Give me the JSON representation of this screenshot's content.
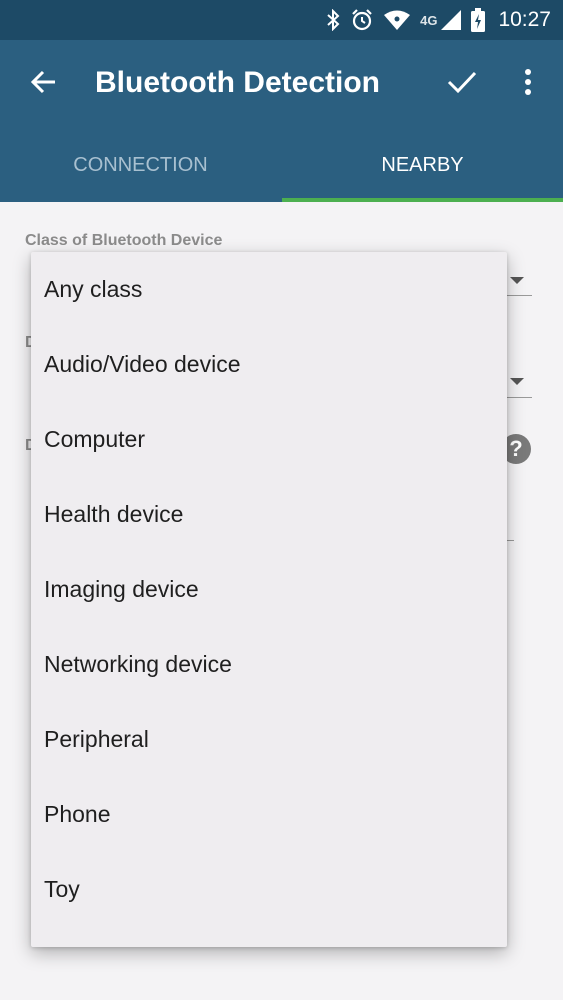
{
  "status_bar": {
    "network": "4G",
    "time": "10:27",
    "icons": [
      "bluetooth-icon",
      "alarm-icon",
      "wifi-icon",
      "signal-icon",
      "battery-icon"
    ]
  },
  "app_bar": {
    "title": "Bluetooth Detection",
    "icons": [
      "back-arrow-icon",
      "check-icon",
      "more-vert-icon"
    ]
  },
  "tabs": [
    {
      "label": "CONNECTION",
      "selected": false
    },
    {
      "label": "NEARBY",
      "selected": true
    }
  ],
  "form": {
    "class_label": "Class of Bluetooth Device",
    "second_label_visible": "D",
    "third_label_visible": "D"
  },
  "dropdown": {
    "options": [
      "Any class",
      "Audio/Video device",
      "Computer",
      "Health device",
      "Imaging device",
      "Networking device",
      "Peripheral",
      "Phone",
      "Toy"
    ]
  },
  "colors": {
    "status_bar": "#1d4a66",
    "app_bar": "#2b5f80",
    "tab_indicator": "#4caf50",
    "background": "#f4f3f5",
    "dropdown_background": "#efedf0"
  }
}
